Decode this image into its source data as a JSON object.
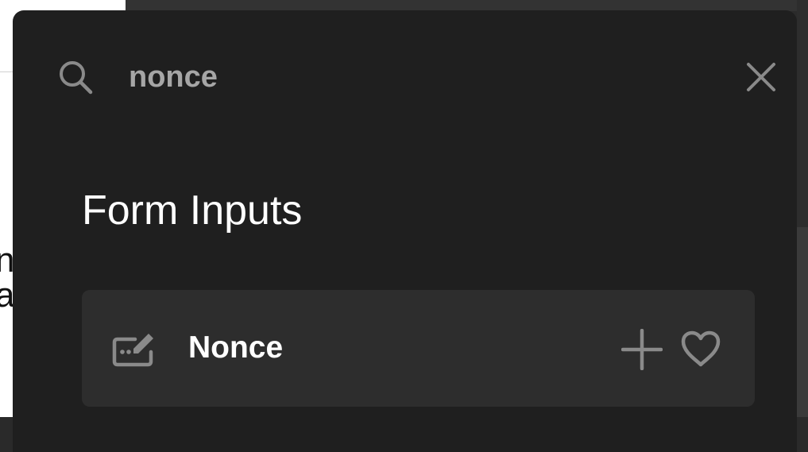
{
  "search": {
    "value": "nonce",
    "icon": "search-icon",
    "close_icon": "close-icon"
  },
  "section": {
    "title": "Form Inputs"
  },
  "results": [
    {
      "label": "Nonce",
      "icon": "edit-field-icon",
      "actions": [
        "add-icon",
        "heart-icon"
      ]
    }
  ],
  "background": {
    "partial_text": "n\na"
  },
  "colors": {
    "popup_bg": "#1f1f1f",
    "item_bg": "#2d2d2d",
    "icon_gray": "#8a8a8a",
    "text_white": "#ffffff",
    "query_text": "#a6a6a6"
  }
}
